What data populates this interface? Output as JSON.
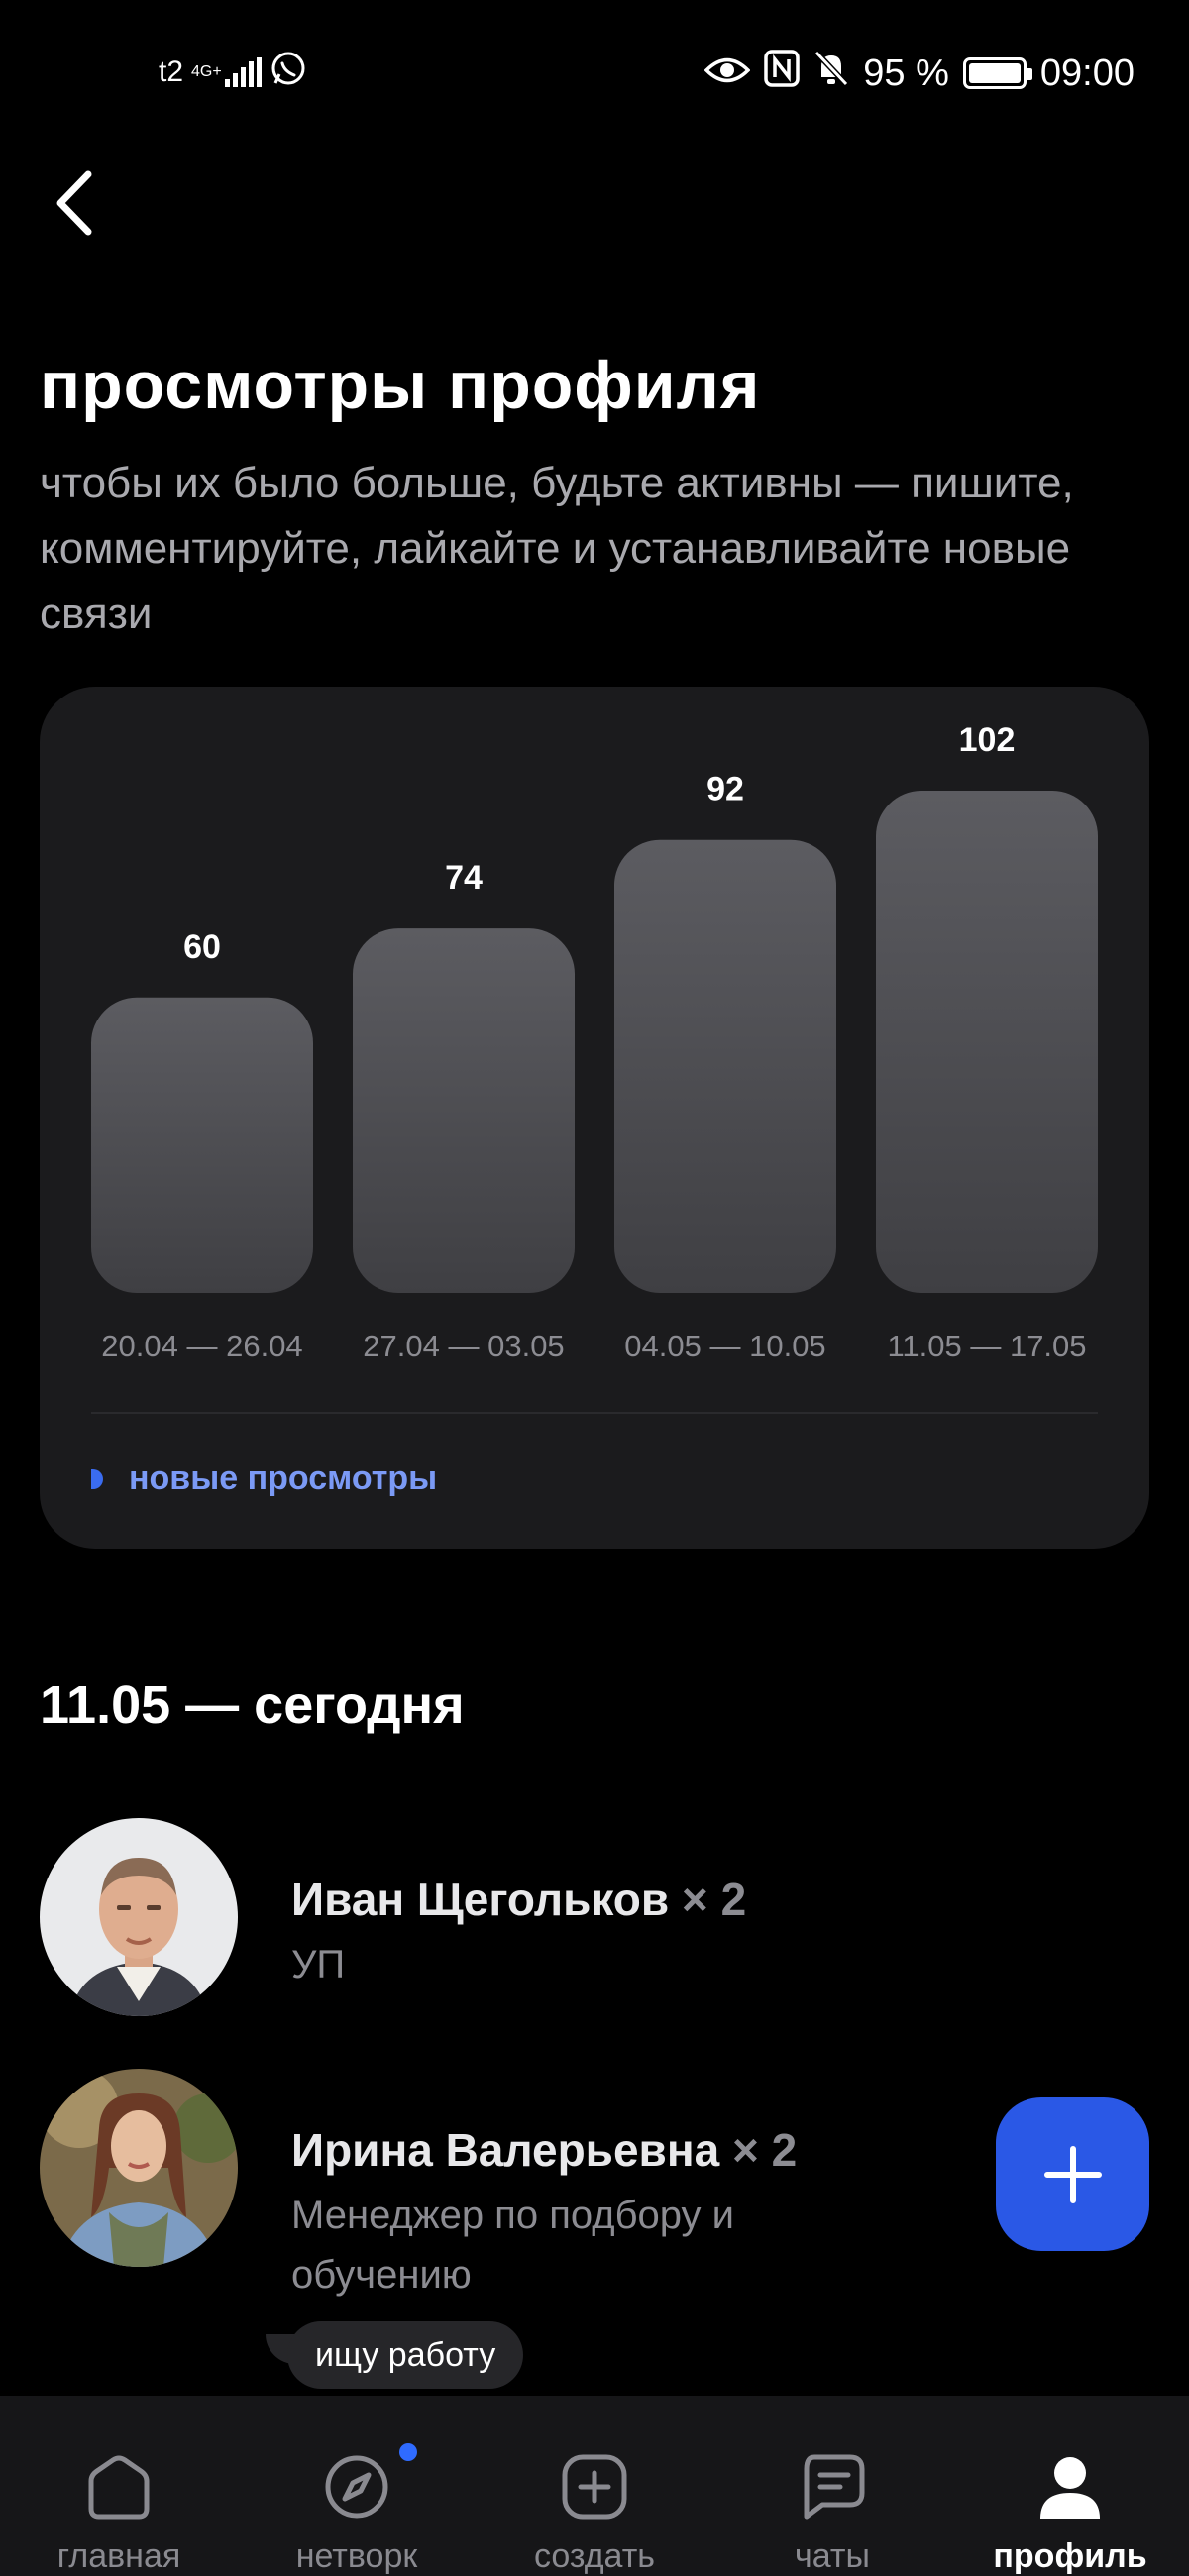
{
  "status_bar": {
    "carrier": "t2",
    "network": "4G+",
    "battery": "95 %",
    "time": "09:00",
    "icons": [
      "signal-icon",
      "whatsapp-icon",
      "eye-icon",
      "nfc-icon",
      "mute-icon",
      "battery-icon"
    ]
  },
  "header": {
    "back_icon": "chevron-left-icon",
    "title": "просмотры профиля",
    "subtitle": "чтобы их было больше, будьте активны — пишите, комментируйте, лайкайте и устанавливайте новые связи"
  },
  "chart_data": {
    "type": "bar",
    "categories": [
      "20.04 — 26.04",
      "27.04 — 03.05",
      "04.05 — 10.05",
      "11.05 — 17.05"
    ],
    "values": [
      60,
      74,
      92,
      102
    ],
    "title": "",
    "xlabel": "",
    "ylabel": "",
    "ylim": [
      0,
      102
    ],
    "grid": false,
    "legend": {
      "label": "новые просмотры",
      "color": "#3a6cf0",
      "placement": "bottom-left"
    },
    "bar_color_top": "#5c5c61",
    "bar_color_bottom": "#3f3f43"
  },
  "section": {
    "title": "11.05 — сегодня"
  },
  "viewers": [
    {
      "name": "Иван Щегольков",
      "count": "× 2",
      "role": "УП",
      "avatar_icon": "avatar-photo"
    },
    {
      "name": "Ирина Валерьевна",
      "count": "× 2",
      "role": "Менеджер по подбору и обучению",
      "avatar_icon": "avatar-photo"
    }
  ],
  "tag": {
    "label": "ищу работу"
  },
  "fab": {
    "icon": "plus-icon",
    "color": "#2a58e6"
  },
  "bottom_nav": {
    "items": [
      {
        "label": "главная",
        "icon": "home-icon"
      },
      {
        "label": "нетворк",
        "icon": "compass-icon"
      },
      {
        "label": "создать",
        "icon": "plus-square-icon"
      },
      {
        "label": "чаты",
        "icon": "chat-icon"
      },
      {
        "label": "профиль",
        "icon": "profile-icon"
      }
    ],
    "active": "профиль"
  }
}
